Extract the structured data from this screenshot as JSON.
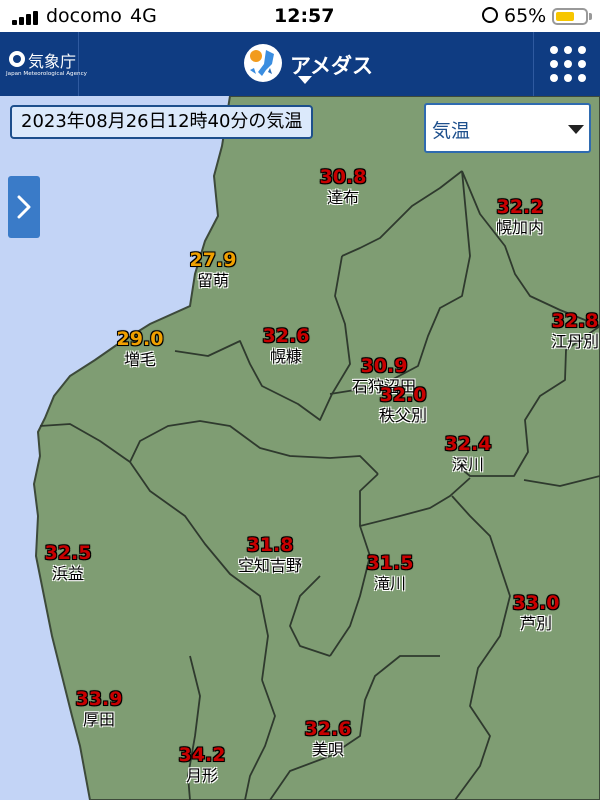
{
  "status_bar": {
    "carrier": "docomo",
    "network": "4G",
    "time": "12:57",
    "battery": "65%",
    "battery_level": 0.65
  },
  "header": {
    "logo_name": "気象庁",
    "logo_sub": "Japan Meteorological Agency",
    "title": "アメダス",
    "icons": {
      "logo": "jma-logo-icon",
      "amedas": "amedas-map-icon",
      "menu": "grid-menu-icon"
    },
    "colors": {
      "header_bg": "#0f3c82"
    }
  },
  "map": {
    "observation_time": "2023年08月26日12時40分の気温",
    "element_select": {
      "selected": "気温"
    },
    "side_tab_icon": "chevron-right-icon",
    "colors": {
      "land": "#7f9d73",
      "sea": "#c3d4f6",
      "hot": "#c80000",
      "warm": "#f0a000"
    },
    "stations": [
      {
        "name": "達布",
        "value": "30.8",
        "level": "hot"
      },
      {
        "name": "幌加内",
        "value": "32.2",
        "level": "hot"
      },
      {
        "name": "留萌",
        "value": "27.9",
        "level": "warm"
      },
      {
        "name": "江丹別",
        "value": "32.8",
        "level": "hot"
      },
      {
        "name": "増毛",
        "value": "29.0",
        "level": "warm"
      },
      {
        "name": "幌糠",
        "value": "32.6",
        "level": "hot"
      },
      {
        "name": "石狩沼田",
        "value": "30.9",
        "level": "hot"
      },
      {
        "name": "秩父別",
        "value": "32.0",
        "level": "hot"
      },
      {
        "name": "深川",
        "value": "32.4",
        "level": "hot"
      },
      {
        "name": "浜益",
        "value": "32.5",
        "level": "hot"
      },
      {
        "name": "空知吉野",
        "value": "31.8",
        "level": "hot"
      },
      {
        "name": "滝川",
        "value": "31.5",
        "level": "hot"
      },
      {
        "name": "芦別",
        "value": "33.0",
        "level": "hot"
      },
      {
        "name": "厚田",
        "value": "33.9",
        "level": "hot"
      },
      {
        "name": "美唄",
        "value": "32.6",
        "level": "hot"
      },
      {
        "name": "月形",
        "value": "34.2",
        "level": "hot"
      }
    ]
  }
}
